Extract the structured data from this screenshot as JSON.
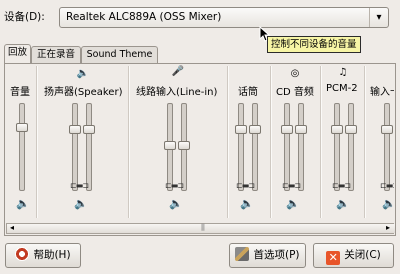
{
  "device": {
    "label": "设备(D):",
    "selected": "Realtek ALC889A (OSS Mixer)"
  },
  "tooltip": "控制不同设备的音量",
  "tabs": [
    "回放",
    "正在录音",
    "Sound Theme"
  ],
  "channels": [
    {
      "label": "音量",
      "icon": "",
      "sliders": 1,
      "levels": [
        0.75
      ]
    },
    {
      "label": "扬声器(Speaker)",
      "icon": "🔈",
      "sliders": 2,
      "levels": [
        0.72,
        0.72
      ]
    },
    {
      "label": "线路输入(Line-in)",
      "icon": "🎤",
      "sliders": 2,
      "levels": [
        0.52,
        0.52
      ]
    },
    {
      "label": "话筒",
      "icon": "",
      "sliders": 2,
      "levels": [
        0.72,
        0.72
      ]
    },
    {
      "label": "CD 音频",
      "icon": "◎",
      "sliders": 2,
      "levels": [
        0.72,
        0.72
      ]
    },
    {
      "label": "PCM-2",
      "icon": "♫",
      "sliders": 2,
      "levels": [
        0.72,
        0.72
      ]
    },
    {
      "label": "输入卡",
      "icon": "",
      "sliders": 1,
      "levels": [
        0.72
      ]
    }
  ],
  "buttons": {
    "help": "帮助(H)",
    "preferences": "首选项(P)",
    "close": "关闭(C)"
  },
  "colors": {
    "tooltip_bg": "#f7f5a5",
    "close_icon": "#e8552a",
    "help_icon": "#c23b22"
  }
}
